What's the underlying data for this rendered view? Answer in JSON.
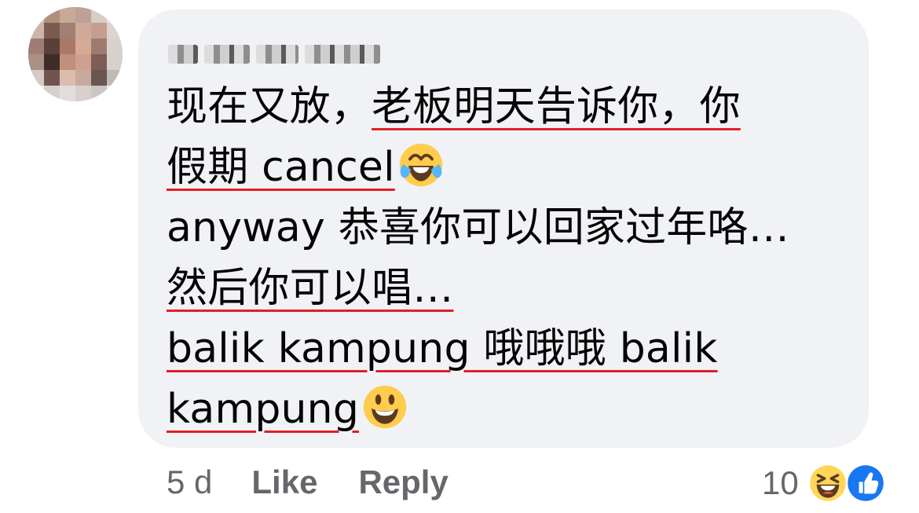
{
  "comment": {
    "author_name_visible": "",
    "text_lines": [
      {
        "parts": [
          {
            "text": "现在又放，"
          },
          {
            "text": "老板明天告诉你，你",
            "underline": true
          }
        ]
      },
      {
        "parts": [
          {
            "text": "假期 cancel",
            "underline": true
          }
        ],
        "emoji": "tears-of-joy-emoji"
      },
      {
        "parts": [
          {
            "text": "anyway 恭喜你可以回家过年咯…"
          }
        ]
      },
      {
        "parts": [
          {
            "text": "然后你可以唱…",
            "underline": true
          }
        ]
      },
      {
        "parts": [
          {
            "text": "balik kampung 哦哦哦 balik",
            "underline": true
          }
        ]
      },
      {
        "parts": [
          {
            "text": "kampung",
            "underline": true
          }
        ],
        "emoji": "grinning-face-emoji"
      }
    ]
  },
  "meta": {
    "time": "5 d",
    "like_label": "Like",
    "reply_label": "Reply"
  },
  "reactions": {
    "count": "10",
    "icons": [
      "laughing-reaction-icon",
      "like-reaction-icon"
    ]
  },
  "colors": {
    "bubble": "#f0f2f5",
    "text": "#050505",
    "meta": "#65676b",
    "underline": "#e11f26",
    "like": "#1877f2",
    "emoji_yellow": "#ffcc4d"
  }
}
